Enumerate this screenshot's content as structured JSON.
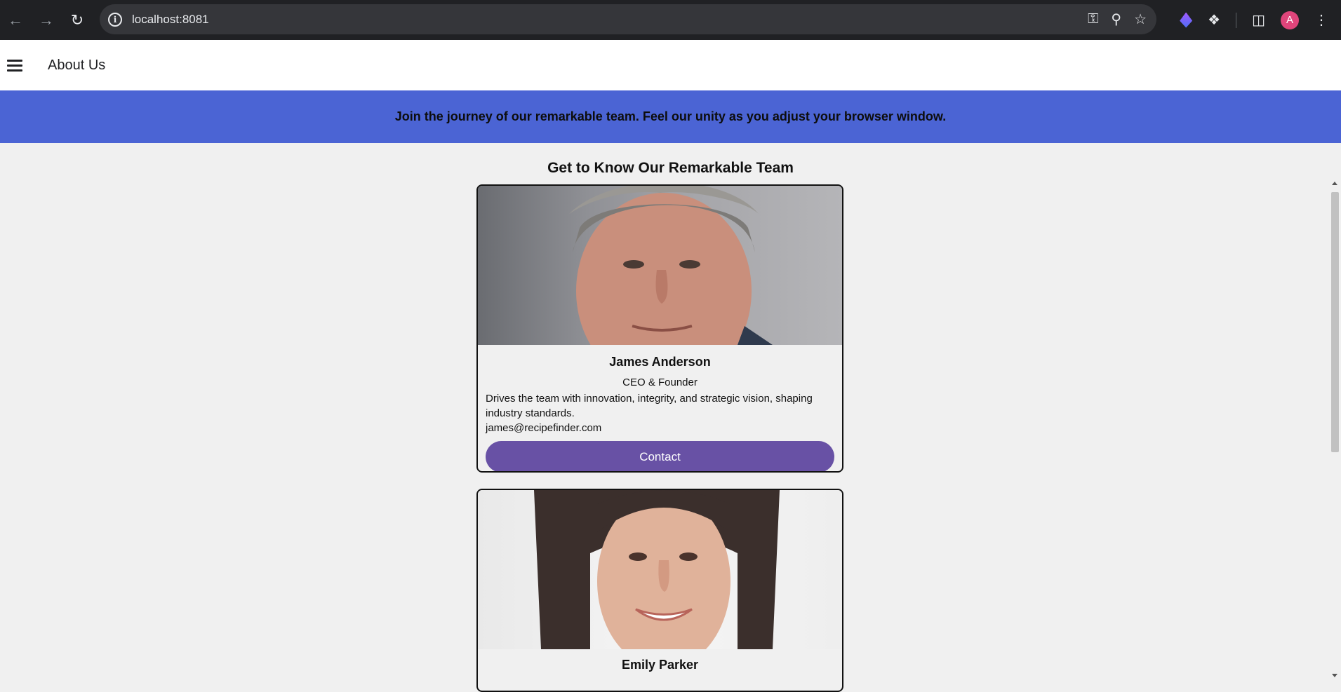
{
  "browser": {
    "url": "localhost:8081",
    "avatar_letter": "A",
    "icons": [
      "back-icon",
      "forward-icon",
      "reload-icon",
      "info-icon",
      "key-icon",
      "zoom-icon",
      "star-icon",
      "extension-gem-icon",
      "extensions-icon",
      "sidepanel-icon",
      "menu-dots-icon"
    ]
  },
  "header": {
    "title": "About Us"
  },
  "banner": {
    "text": "Join the journey of our remarkable team. Feel our unity as you adjust your browser window.",
    "color": "#4b64d4"
  },
  "section": {
    "title": "Get to Know Our Remarkable Team"
  },
  "team": [
    {
      "name": "James Anderson",
      "role": "CEO & Founder",
      "description": "Drives the team with innovation, integrity, and strategic vision, shaping industry standards.",
      "email": "james@recipefinder.com",
      "button_label": "Contact"
    },
    {
      "name": "Emily Parker"
    }
  ],
  "colors": {
    "button": "#6851a5",
    "avatar": "#e0457b"
  }
}
